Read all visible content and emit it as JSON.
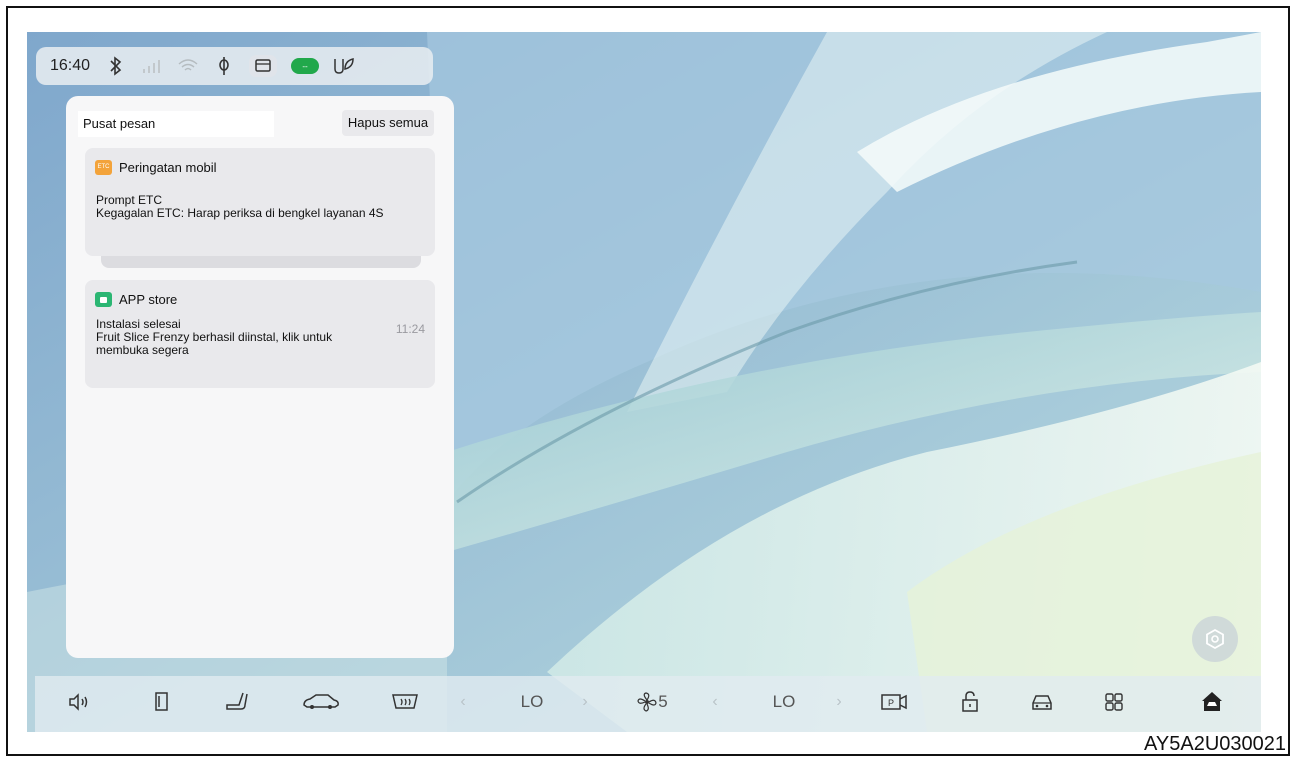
{
  "status": {
    "time": "16:40",
    "icons": [
      "bluetooth-icon",
      "signal-icon",
      "wifi-icon",
      "microphone-off-icon",
      "message-icon",
      "battery-pill-icon",
      "connected-icon"
    ],
    "pill_text": "--",
    "accent": "#21a84b"
  },
  "panel": {
    "title": "Pusat pesan",
    "clear_all": "Hapus semua"
  },
  "notifications": [
    {
      "app": "Peringatan mobil",
      "app_badge": "ETC",
      "title": "Prompt ETC",
      "body": "Kegagalan ETC: Harap periksa di bengkel layanan 4S",
      "time": ""
    },
    {
      "app": "APP store",
      "app_badge": "",
      "title": "Instalasi selesai",
      "body": "Fruit Slice Frenzy berhasil diinstal, klik untuk membuka segera",
      "time": "11:24"
    }
  ],
  "dock": {
    "left_temp": "LO",
    "fan": "5",
    "right_temp": "LO",
    "icons": [
      "volume-icon",
      "door-icon",
      "seat-icon",
      "car-side-icon",
      "rear-defrost-icon",
      "fan-icon",
      "camera-icon",
      "lock-icon",
      "car-front-icon",
      "apps-grid-icon",
      "home-car-icon"
    ]
  },
  "figure_code": "AY5A2U030021"
}
